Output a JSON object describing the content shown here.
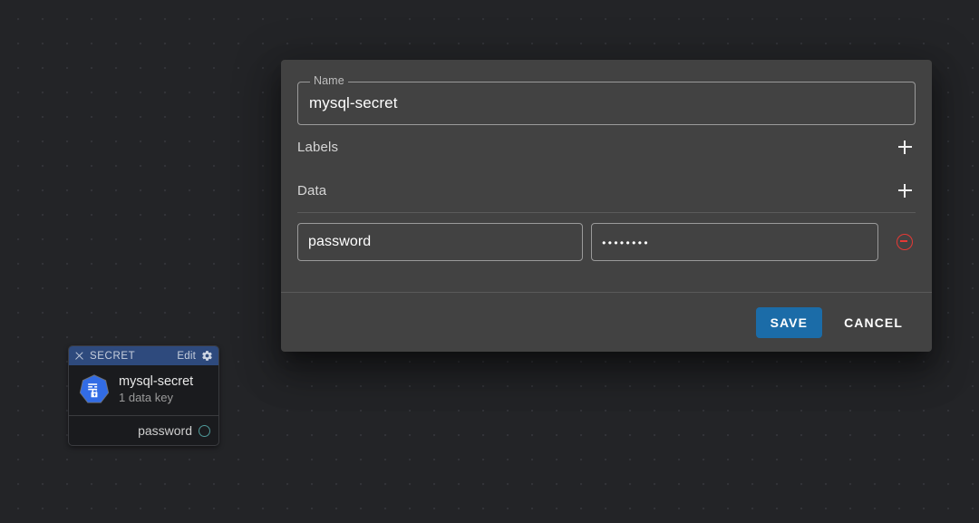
{
  "canvas": {
    "background_color": "#232427",
    "dot_color": "#323338"
  },
  "dialog": {
    "name_field": {
      "legend": "Name",
      "value": "mysql-secret",
      "placeholder": "Name"
    },
    "sections": [
      {
        "title": "Labels",
        "add_icon": "plus-icon",
        "has_divider": false
      },
      {
        "title": "Data",
        "add_icon": "plus-icon",
        "has_divider": true
      }
    ],
    "data_rows": [
      {
        "key": "password",
        "key_placeholder": "Key",
        "value": "••••••••",
        "value_placeholder": "Value",
        "remove_icon": "minus-circle-icon"
      }
    ],
    "footer": {
      "save_label": "SAVE",
      "cancel_label": "CANCEL",
      "save_color": "#1b6ca8"
    }
  },
  "node": {
    "header": {
      "close_icon": "close-icon",
      "kind": "SECRET",
      "edit_label": "Edit",
      "gear_icon": "gear-icon",
      "color": "#2e4a7d"
    },
    "icon": "kubernetes-secret-icon",
    "name": "mysql-secret",
    "subtitle": "1 data key",
    "ports": [
      {
        "label": "password",
        "dot_icon": "port-circle-icon",
        "dot_color": "#4f9a9a"
      }
    ]
  }
}
